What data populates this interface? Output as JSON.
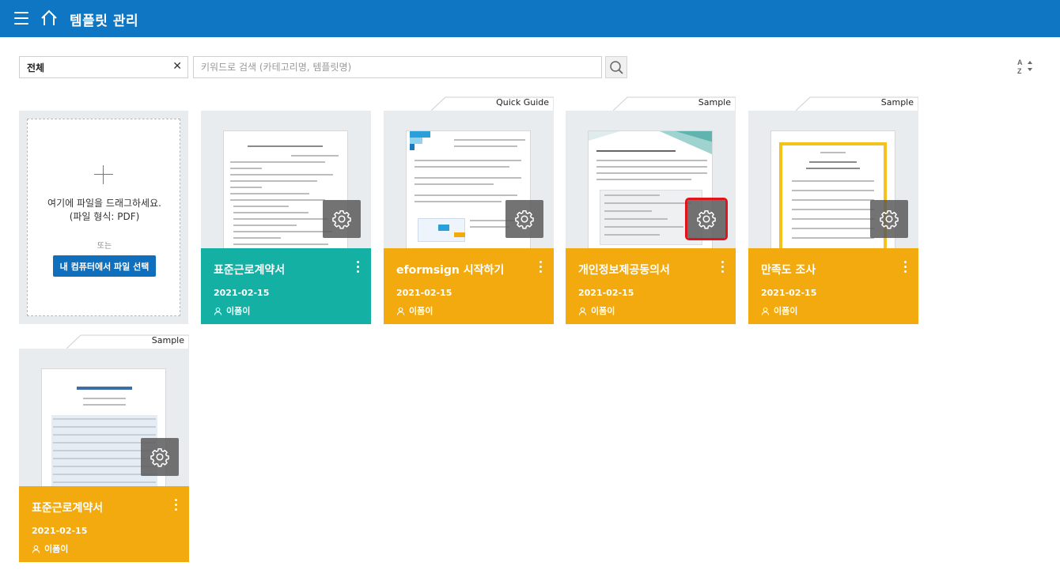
{
  "header": {
    "title": "템플릿 관리",
    "menu_icon": "hamburger-menu-icon",
    "home_icon": "home-icon"
  },
  "filter": {
    "category_value": "전체",
    "clear_symbol": "✕",
    "search_placeholder": "키워드로 검색 (카테고리명, 템플릿명)",
    "search_icon": "search-icon",
    "sort_icon": "sort-az-icon"
  },
  "upload": {
    "drop_line1": "여기에 파일을 드래그하세요.",
    "drop_line2": "(파일 형식: PDF)",
    "or_label": "또는",
    "button_label": "내 컴퓨터에서 파일 선택"
  },
  "cards": [
    {
      "name": "표준근로계약서",
      "date": "2021-02-15",
      "owner": "이폼이",
      "tag": "",
      "color": "#14b0a3"
    },
    {
      "name": "eformsign 시작하기",
      "date": "2021-02-15",
      "owner": "이폼이",
      "tag": "Quick Guide",
      "color": "#f2aa0e"
    },
    {
      "name": "개인정보제공동의서",
      "date": "2021-02-15",
      "owner": "이폼이",
      "tag": "Sample",
      "color": "#f2aa0e",
      "gear_highlighted": true
    },
    {
      "name": "만족도 조사",
      "date": "2021-02-15",
      "owner": "이폼이",
      "tag": "Sample",
      "color": "#f2aa0e"
    },
    {
      "name": "표준근로계약서",
      "date": "2021-02-15",
      "owner": "이폼이",
      "tag": "Sample",
      "color": "#f2aa0e"
    }
  ],
  "colors": {
    "header_blue": "#0f76c4",
    "teal": "#14b0a3",
    "amber": "#f2aa0e",
    "highlight_red": "#e0141c"
  }
}
